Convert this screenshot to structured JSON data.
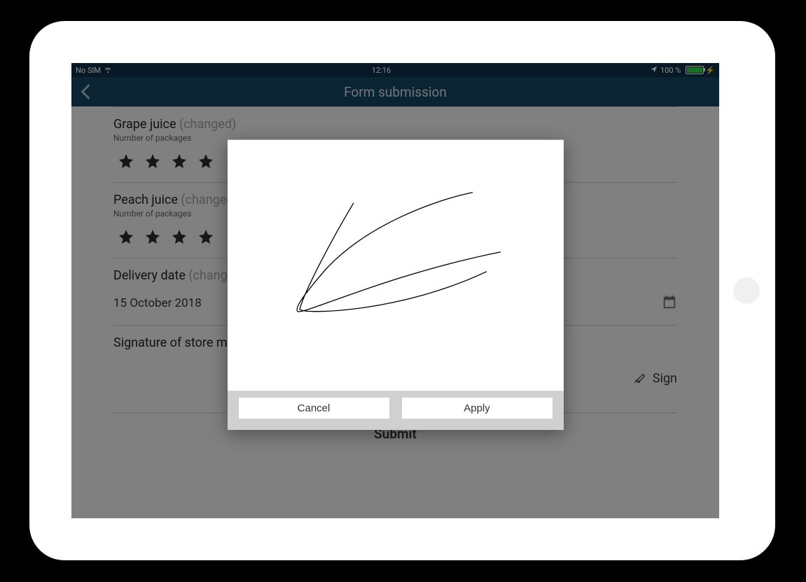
{
  "status": {
    "sim": "No SIM",
    "time": "12:16",
    "battery_pct": "100 %"
  },
  "nav": {
    "title": "Form submission"
  },
  "items": [
    {
      "title": "Grape juice",
      "changed": "(changed)",
      "subtext": "Number of packages"
    },
    {
      "title": "Peach juice",
      "changed": "(changed)",
      "subtext": "Number of packages"
    }
  ],
  "delivery": {
    "label": "Delivery date",
    "changed": "(changed)",
    "value": "15 October 2018"
  },
  "signature": {
    "label": "Signature of store manager",
    "button": "Sign"
  },
  "submit_label": "Submit",
  "modal": {
    "cancel": "Cancel",
    "apply": "Apply"
  }
}
